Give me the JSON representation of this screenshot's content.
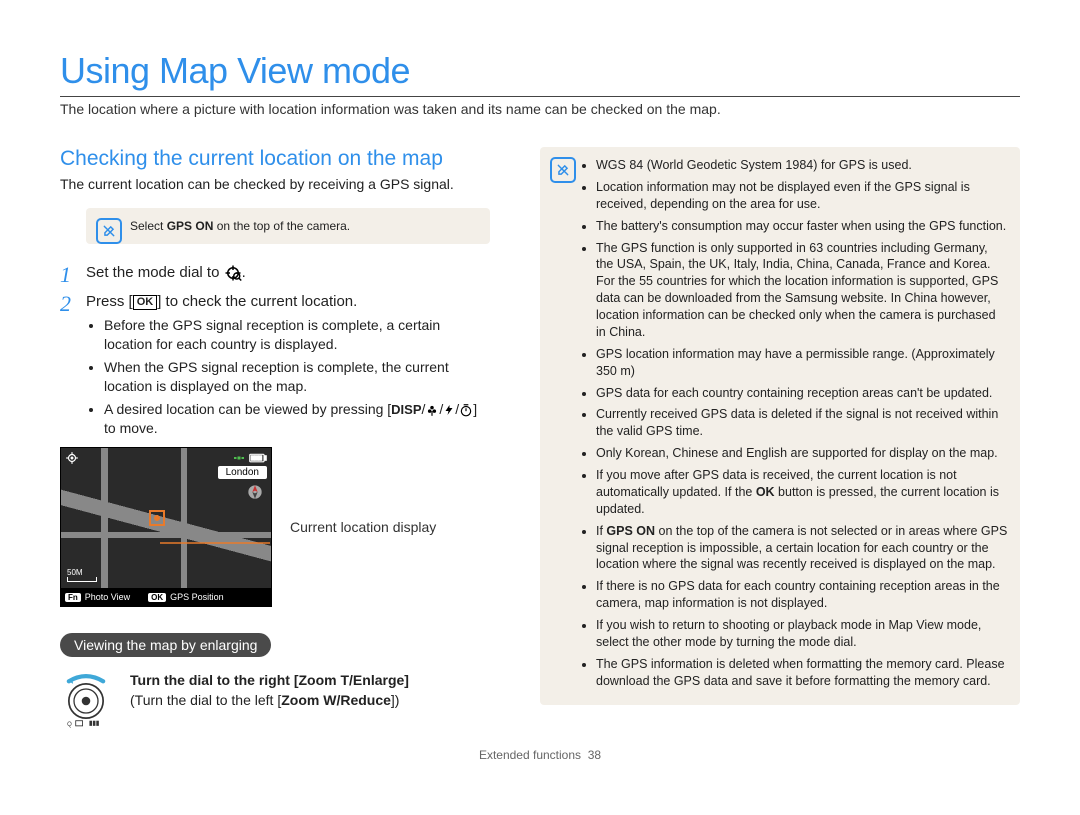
{
  "title": "Using Map View mode",
  "intro": "The location where a picture with location information was taken and its name can be checked on the map.",
  "section_head": "Checking the current location on the map",
  "section_body": "The current location can be checked by receiving a GPS signal.",
  "note_small_pre": "Select ",
  "note_small_bold": "GPS ON",
  "note_small_post": " on the top of the camera.",
  "steps": {
    "s1": "Set the mode dial to ",
    "s2_pre": "Press [",
    "s2_ok": "OK",
    "s2_post": "] to check the current location.",
    "s2_b1": "Before the GPS signal reception is complete, a certain location for each country is displayed.",
    "s2_b2": "When the GPS signal reception is complete, the current location is displayed on the map.",
    "s2_b3_pre": "A desired location can be viewed by pressing [",
    "s2_b3_disp": "DISP",
    "s2_b3_post": "] to move."
  },
  "map": {
    "city": "London",
    "scale": "50M",
    "photo_view": "Photo View",
    "gps_position": "GPS Position",
    "fn": "Fn",
    "ok": "OK"
  },
  "callout": "Current location display",
  "sub_heading": "Viewing the map by enlarging",
  "dial": {
    "line1_pre": "Turn the dial to the right [",
    "line1_bold": "Zoom T/Enlarge",
    "line1_post": "]",
    "line2_pre": "(Turn the dial to the left [",
    "line2_bold": "Zoom W/Reduce",
    "line2_post": "])"
  },
  "right_notes": {
    "n1": "WGS 84 (World Geodetic System 1984) for GPS is used.",
    "n2": "Location information may not be displayed even if the GPS signal is received, depending on the area for use.",
    "n3": "The battery's consumption may occur faster when using the GPS function.",
    "n4": "The GPS function is only supported in 63 countries including Germany, the USA, Spain, the UK, Italy, India, China, Canada, France and Korea. For the 55 countries for which the location information is supported, GPS data can be downloaded from the Samsung website. In China however, location information can be checked only when the camera is purchased in China.",
    "n5": "GPS location information may have a permissible range. (Approximately 350 m)",
    "n6": "GPS data for each country containing reception areas can't be updated.",
    "n7": "Currently received GPS data is deleted if the signal is not received within the valid GPS time.",
    "n8": "Only Korean, Chinese and English are supported for display on the map.",
    "n9_pre": "If you move after GPS data is received, the current location is not automatically updated. If the ",
    "n9_bold": "OK",
    "n9_post": " button is pressed, the current location is updated.",
    "n10_pre": "If ",
    "n10_bold": "GPS ON",
    "n10_post": " on the top of the camera is not selected or in areas where GPS signal reception is impossible, a certain location for each country or the location where the signal was recently received is displayed on the map.",
    "n11": "If there is no GPS data for each country containing reception areas in the camera, map information is not displayed.",
    "n12": "If you wish to return to shooting or playback mode in Map View mode, select the other mode by turning the mode dial.",
    "n13": "The GPS information is deleted when formatting the memory card. Please download the GPS data and save it before formatting the memory card."
  },
  "footer_label": "Extended functions",
  "footer_page": "38"
}
